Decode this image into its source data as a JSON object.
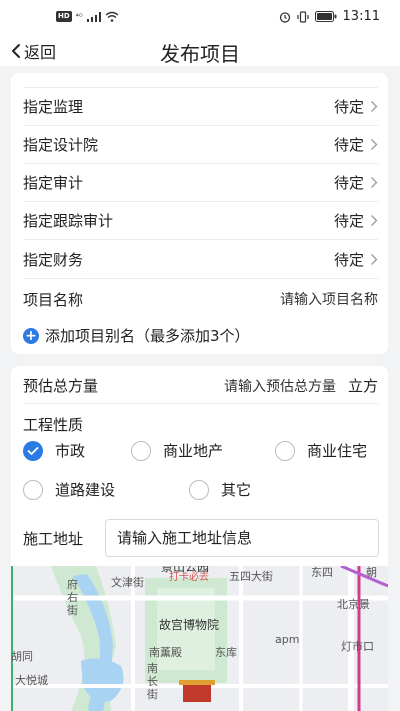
{
  "status_bar": {
    "hd": "HD",
    "signal": "⁴ᴳ",
    "time": "13:11"
  },
  "nav": {
    "back_label": "返回",
    "title": "发布项目"
  },
  "assignments": [
    {
      "label": "指定监理",
      "value": "待定"
    },
    {
      "label": "指定设计院",
      "value": "待定"
    },
    {
      "label": "指定审计",
      "value": "待定"
    },
    {
      "label": "指定跟踪审计",
      "value": "待定"
    },
    {
      "label": "指定财务",
      "value": "待定"
    }
  ],
  "project_name": {
    "label": "项目名称",
    "placeholder": "请输入项目名称"
  },
  "add_alias": {
    "label": "添加项目别名（最多添加3个）"
  },
  "volume": {
    "label": "预估总方量",
    "placeholder": "请输入预估总方量",
    "unit": "立方"
  },
  "nature": {
    "label": "工程性质",
    "options": [
      {
        "label": "市政",
        "checked": true
      },
      {
        "label": "商业地产",
        "checked": false
      },
      {
        "label": "商业住宅",
        "checked": false
      },
      {
        "label": "道路建设",
        "checked": false
      },
      {
        "label": "其它",
        "checked": false
      }
    ]
  },
  "address": {
    "label": "施工地址",
    "placeholder": "请输入施工地址信息"
  },
  "map": {
    "labels": [
      "景山公园",
      "打卡必去",
      "五四大街",
      "东四",
      "朝",
      "府右街",
      "文津街",
      "北京景",
      "故宫博物院",
      "apm",
      "灯市口",
      "南薰殿",
      "东库",
      "胡同",
      "南长街",
      "大悦城"
    ]
  },
  "colors": {
    "accent": "#2c7be5",
    "background": "#f2f3f5",
    "card": "#ffffff"
  }
}
